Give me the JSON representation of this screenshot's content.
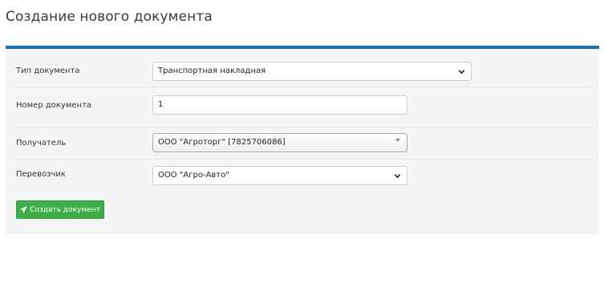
{
  "page": {
    "title": "Создание нового документа"
  },
  "form": {
    "doc_type": {
      "label": "Тип документа",
      "value": "Транспортная накладная"
    },
    "doc_number": {
      "label": "Номер документа",
      "value": "1"
    },
    "recipient": {
      "label": "Получатель",
      "value": "ООО \"Агроторг\" [7825706086]"
    },
    "carrier": {
      "label": "Перевозчик",
      "value": "ООО \"Агро-Авто\""
    },
    "submit_label": "Создать документ"
  },
  "colors": {
    "panel_accent": "#1a72b8",
    "submit_button": "#3fae48"
  },
  "icons": {
    "submit": "paper-plane-icon",
    "dropdown": "chevron-down-icon"
  }
}
